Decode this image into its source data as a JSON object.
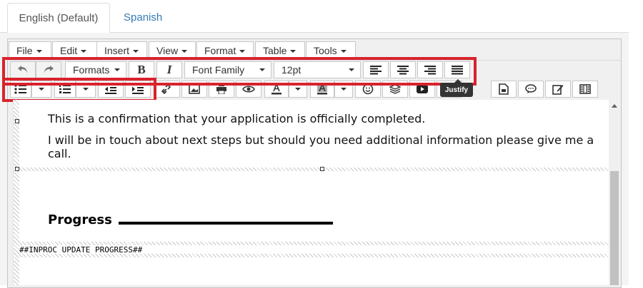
{
  "tabs": [
    {
      "label": "English (Default)",
      "active": true
    },
    {
      "label": "Spanish",
      "active": false
    }
  ],
  "menubar": {
    "items": [
      "File",
      "Edit",
      "Insert",
      "View",
      "Format",
      "Table",
      "Tools"
    ]
  },
  "toolbar": {
    "formats_label": "Formats",
    "bold_label": "B",
    "italic_label": "I",
    "font_family_label": "Font Family",
    "font_size_value": "12pt",
    "justify_tooltip": "Justify"
  },
  "content": {
    "paragraph1": "This is a confirmation that your application is officially completed.",
    "paragraph2": "I will be in touch about next steps but should you need additional information please give me a call.",
    "progress_heading": "Progress",
    "placeholder": "##INPROC_UPDATE_PROGRESS##"
  },
  "icons": [
    "undo-icon",
    "redo-icon",
    "align-left-icon",
    "align-center-icon",
    "align-right-icon",
    "align-justify-icon",
    "bullet-list-icon",
    "numbered-list-icon",
    "outdent-icon",
    "indent-icon",
    "link-icon",
    "image-icon",
    "print-icon",
    "preview-icon",
    "text-color-icon",
    "background-color-icon",
    "emoticons-icon",
    "layers-icon",
    "youtube-icon",
    "template-icon",
    "comment-icon",
    "edit-icon",
    "media-icon"
  ],
  "colors": {
    "highlight_red": "#d9232d",
    "tab_link": "#337ab7"
  }
}
